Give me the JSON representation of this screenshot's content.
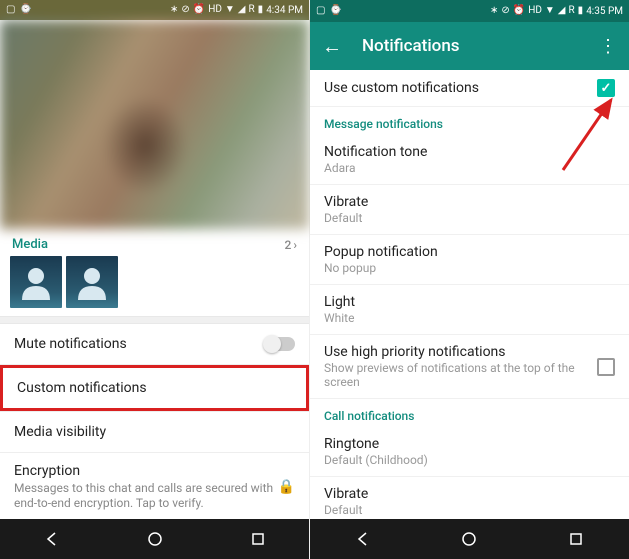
{
  "left": {
    "status": {
      "time": "4:34 PM",
      "hd": "HD",
      "r": "R"
    },
    "media": {
      "label": "Media",
      "count": "2"
    },
    "rows": {
      "mute": "Mute notifications",
      "custom": "Custom notifications",
      "mediavis": "Media visibility",
      "encryption": "Encryption",
      "encryption_sub": "Messages to this chat and calls are secured with end-to-end encryption. Tap to verify."
    }
  },
  "right": {
    "status": {
      "time": "4:35 PM",
      "hd": "HD",
      "r": "R"
    },
    "title": "Notifications",
    "use_custom": "Use custom notifications",
    "section_msg": "Message notifications",
    "section_call": "Call notifications",
    "rows": {
      "tone": "Notification tone",
      "tone_sub": "Adara",
      "vibrate": "Vibrate",
      "vibrate_sub": "Default",
      "popup": "Popup notification",
      "popup_sub": "No popup",
      "light": "Light",
      "light_sub": "White",
      "priority": "Use high priority notifications",
      "priority_sub": "Show previews of notifications at the top of the screen",
      "ringtone": "Ringtone",
      "ringtone_sub": "Default (Childhood)",
      "cvibrate": "Vibrate",
      "cvibrate_sub": "Default"
    }
  }
}
